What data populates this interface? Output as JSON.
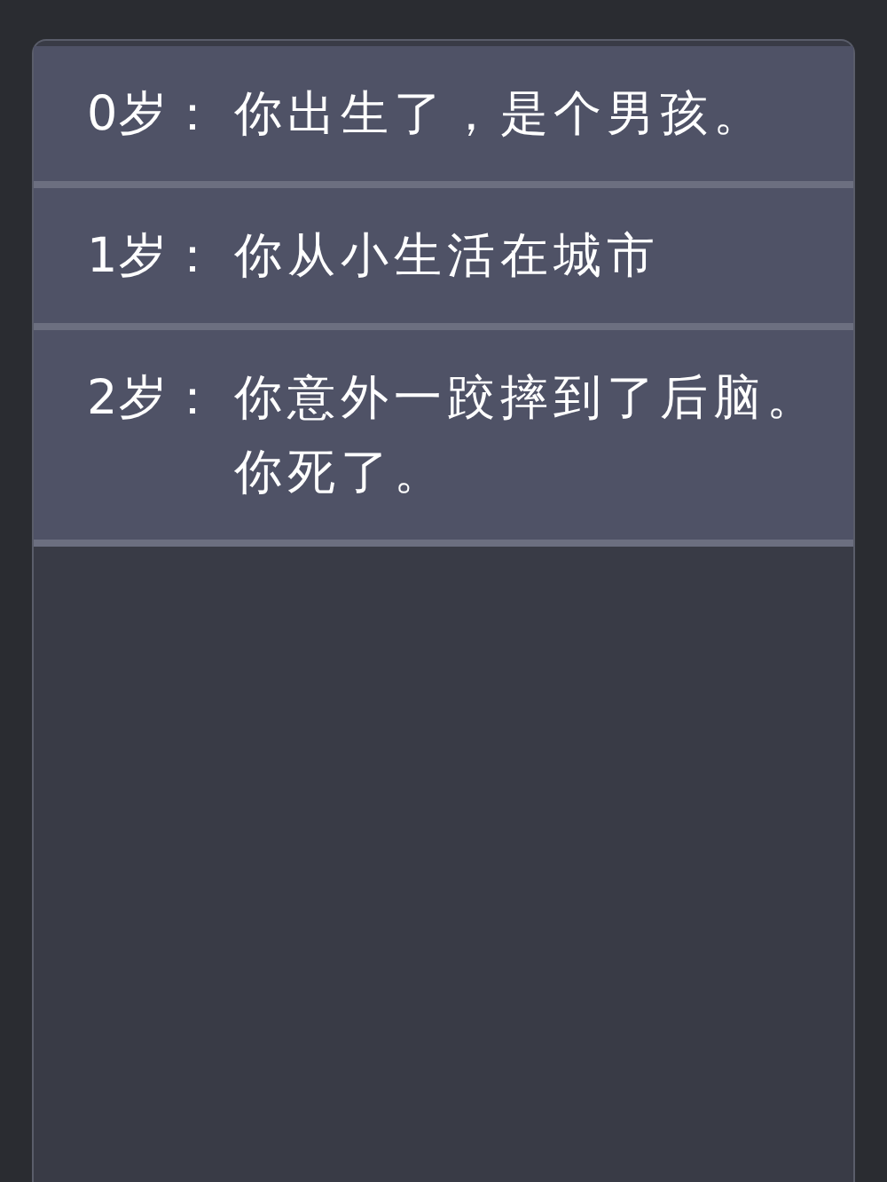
{
  "entries": [
    {
      "age": "0岁：",
      "lines": [
        "你出生了，是个男孩。"
      ]
    },
    {
      "age": "1岁：",
      "lines": [
        "你从小生活在城市"
      ]
    },
    {
      "age": "2岁：",
      "lines": [
        "你意外一跤摔到了后脑。",
        "你死了。"
      ]
    }
  ]
}
